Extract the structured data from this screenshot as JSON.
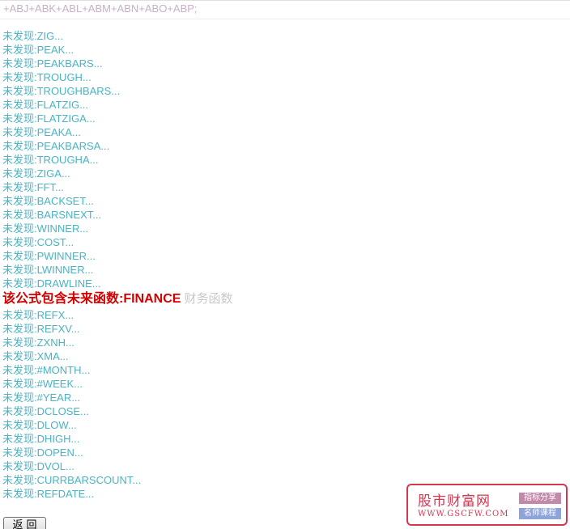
{
  "top_text": "+ABJ+ABK+ABL+ABM+ABN+ABO+ABP;",
  "items_before": [
    "未发现:ZIG...",
    "未发现:PEAK...",
    "未发现:PEAKBARS...",
    "未发现:TROUGH...",
    "未发现:TROUGHBARS...",
    "未发现:FLATZIG...",
    "未发现:FLATZIGA...",
    "未发现:PEAKA...",
    "未发现:PEAKBARSA...",
    "未发现:TROUGHA...",
    "未发现:ZIGA...",
    "未发现:FFT...",
    "未发现:BACKSET...",
    "未发现:BARSNEXT...",
    "未发现:WINNER...",
    "未发现:COST...",
    "未发现:PWINNER...",
    "未发现:LWINNER...",
    "未发现:DRAWLINE..."
  ],
  "warning": {
    "main": "该公式包含未来函数:FINANCE",
    "sub": "财务函数"
  },
  "items_after": [
    "未发现:REFX...",
    "未发现:REFXV...",
    "未发现:ZXNH...",
    "未发现:XMA...",
    "未发现:#MONTH...",
    "未发现:#WEEK...",
    "未发现:#YEAR...",
    "未发现:DCLOSE...",
    "未发现:DLOW...",
    "未发现:DHIGH...",
    "未发现:DOPEN...",
    "未发现:DVOL...",
    "未发现:CURRBARSCOUNT...",
    "未发现:REFDATE..."
  ],
  "back_button_label": "返回",
  "watermark": {
    "title": "股市财富网",
    "url": "WWW.GSCFW.COM",
    "tag1": "指标分享",
    "tag2": "名师课程"
  },
  "colors": {
    "item_text": "#48b4c4",
    "warning_text": "#d40000",
    "watermark": "#d4384f"
  }
}
